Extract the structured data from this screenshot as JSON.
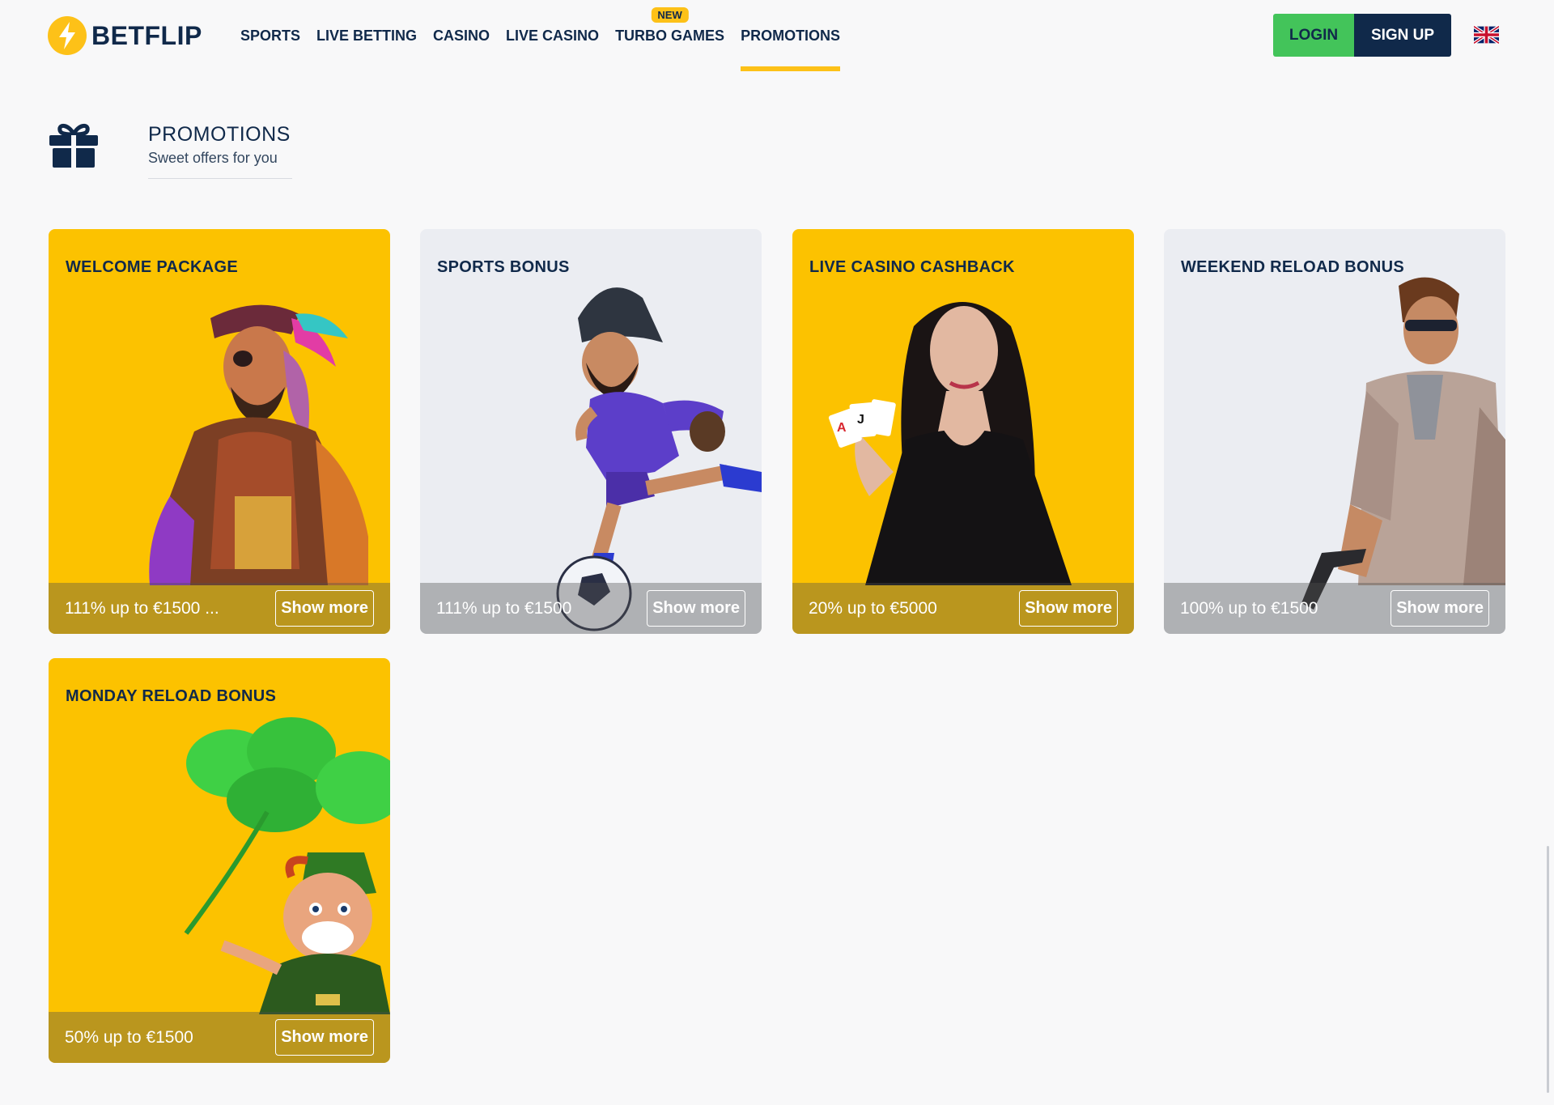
{
  "brand": {
    "name": "BETFLIP"
  },
  "nav": {
    "items": [
      {
        "label": "SPORTS"
      },
      {
        "label": "LIVE BETTING"
      },
      {
        "label": "CASINO"
      },
      {
        "label": "LIVE CASINO"
      },
      {
        "label": "TURBO GAMES",
        "badge": "NEW"
      },
      {
        "label": "PROMOTIONS",
        "active": true
      }
    ]
  },
  "auth": {
    "login_label": "LOGIN",
    "signup_label": "SIGN UP"
  },
  "language": {
    "icon": "uk-flag-icon"
  },
  "page": {
    "title": "PROMOTIONS",
    "subtitle": "Sweet offers for you",
    "icon": "gift-icon"
  },
  "promotions": [
    {
      "title": "WELCOME PACKAGE",
      "offer": "111% up to €1500 ...",
      "button": "Show more",
      "theme": "yellow",
      "art": "pirate-character"
    },
    {
      "title": "SPORTS BONUS",
      "offer": "111% up to €1500",
      "button": "Show more",
      "theme": "grey",
      "art": "football-player-character"
    },
    {
      "title": "LIVE CASINO CASHBACK",
      "offer": "20% up to €5000",
      "button": "Show more",
      "theme": "yellow",
      "art": "dealer-with-cards"
    },
    {
      "title": "WEEKEND RELOAD BONUS",
      "offer": "100% up to €1500",
      "button": "Show more",
      "theme": "grey",
      "art": "agent-with-gun"
    },
    {
      "title": "MONDAY RELOAD BONUS",
      "offer": "50% up to €1500",
      "button": "Show more",
      "theme": "yellow",
      "art": "leprechaun-with-clover"
    }
  ],
  "colors": {
    "accent": "#fcc200",
    "navy": "#10294a",
    "login_green": "#43c45a",
    "background": "#f8f8f9"
  }
}
